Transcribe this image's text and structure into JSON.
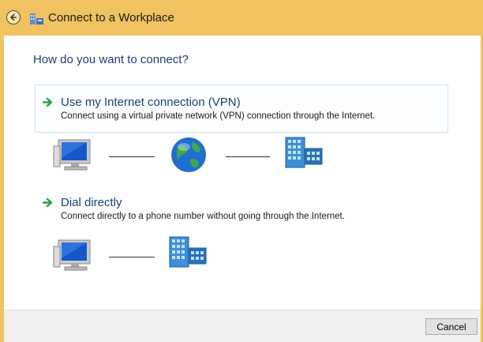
{
  "window": {
    "title": "Connect to a Workplace",
    "frame_color": "#f0c360"
  },
  "main": {
    "heading": "How do you want to connect?",
    "options": [
      {
        "title": "Use my Internet connection (VPN)",
        "description": "Connect using a virtual private network (VPN) connection through the Internet.",
        "icon": "green-arrow-icon",
        "diagram": [
          "computer-icon",
          "globe-icon",
          "office-building-icon"
        ]
      },
      {
        "title": "Dial directly",
        "description": "Connect directly to a phone number without going through the Internet.",
        "icon": "green-arrow-icon",
        "diagram": [
          "computer-icon",
          "office-building-icon"
        ]
      }
    ]
  },
  "footer": {
    "cancel_label": "Cancel"
  },
  "colors": {
    "heading": "#1c3f75",
    "arrow": "#2aa33a",
    "option_border": "#d2e5f2"
  }
}
